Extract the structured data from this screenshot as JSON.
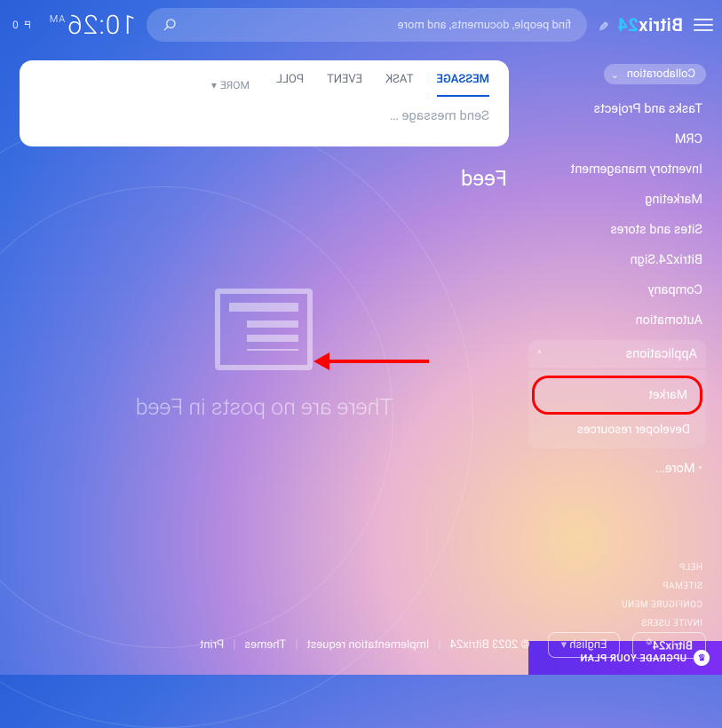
{
  "header": {
    "logo_prefix": "Bitrix",
    "logo_suffix": "24",
    "search_placeholder": "find people, documents, and more",
    "time": "10:26",
    "ampm": "AM",
    "task_counter": "0"
  },
  "sidebar": {
    "collab_label": "Collaboration",
    "items": [
      "Tasks and Projects",
      "CRM",
      "Inventory management",
      "Marketing",
      "Sites and stores",
      "Bitrix24.Sign",
      "Company",
      "Automation"
    ],
    "apps_label": "Applications",
    "apps_items": [
      "Market",
      "Developer resources"
    ],
    "more_label": "More...",
    "mini": [
      "HELP",
      "SITEMAP",
      "CONFIGURE MENU",
      "INVITE USERS"
    ],
    "upgrade_label": "UPGRADE YOUR PLAN"
  },
  "composer": {
    "tabs": [
      "MESSAGE",
      "TASK",
      "EVENT",
      "POLL"
    ],
    "more_label": "MORE",
    "placeholder": "Send message …"
  },
  "feed": {
    "title": "Feed",
    "empty_text": "There are no posts in Feed"
  },
  "footer": {
    "brand": "Bitrix24",
    "lang": "English",
    "copyright": "© 2023 Bitrix24",
    "links": [
      "Implementation request",
      "Themes",
      "Print"
    ]
  }
}
